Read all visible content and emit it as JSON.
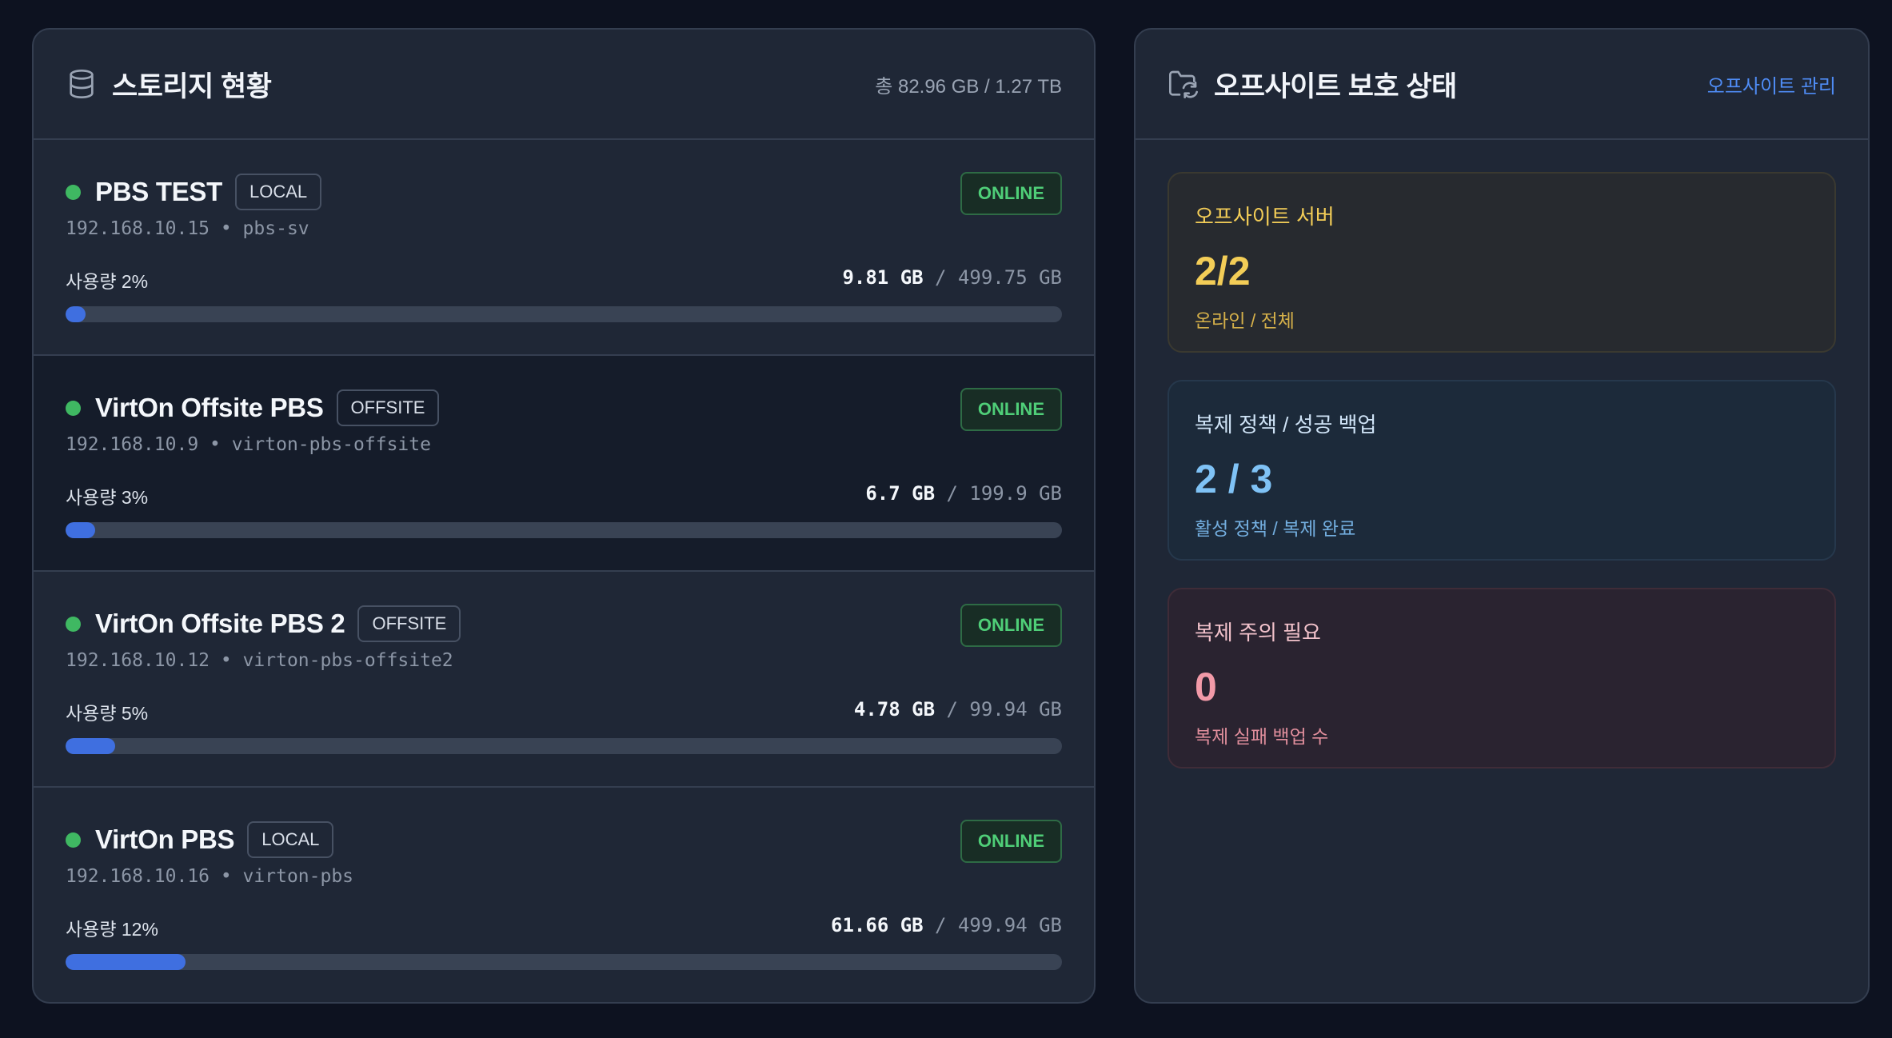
{
  "storage": {
    "title": "스토리지 현황",
    "total": "총 82.96 GB / 1.27 TB",
    "servers": [
      {
        "name": "PBS TEST",
        "tag": "LOCAL",
        "status": "ONLINE",
        "sub": "192.168.10.15 • pbs-sv",
        "usage_label": "사용량 2%",
        "used": "9.81 GB",
        "total": " / 499.75 GB",
        "percent": 2
      },
      {
        "name": "VirtOn Offsite PBS",
        "tag": "OFFSITE",
        "status": "ONLINE",
        "sub": "192.168.10.9 • virton-pbs-offsite",
        "usage_label": "사용량 3%",
        "used": "6.7 GB",
        "total": " / 199.9 GB",
        "percent": 3
      },
      {
        "name": "VirtOn Offsite PBS 2",
        "tag": "OFFSITE",
        "status": "ONLINE",
        "sub": "192.168.10.12 • virton-pbs-offsite2",
        "usage_label": "사용량 5%",
        "used": "4.78 GB",
        "total": " / 99.94 GB",
        "percent": 5
      },
      {
        "name": "VirtOn PBS",
        "tag": "LOCAL",
        "status": "ONLINE",
        "sub": "192.168.10.16 • virton-pbs",
        "usage_label": "사용량 12%",
        "used": "61.66 GB",
        "total": " / 499.94 GB",
        "percent": 12
      }
    ]
  },
  "offsite": {
    "title": "오프사이트 보호 상태",
    "manage_link": "오프사이트 관리",
    "cards": [
      {
        "title": "오프사이트 서버",
        "value": "2/2",
        "sub": "온라인 / 전체"
      },
      {
        "title": "복제 정책 / 성공 백업",
        "value": "2 / 3",
        "sub": "활성 정책 / 복제 완료"
      },
      {
        "title": "복제 주의 필요",
        "value": "0",
        "sub": "복제 실패 백업 수"
      }
    ]
  },
  "colors": {
    "accent": "#4f8cf5",
    "online": "#4fce78",
    "bar": "#3f6fe0",
    "warn": "#f3cd57",
    "info": "#7fc2f5",
    "danger": "#f29aa8"
  },
  "icons": {
    "storage": "database-icon",
    "offsite": "folder-sync-icon"
  }
}
